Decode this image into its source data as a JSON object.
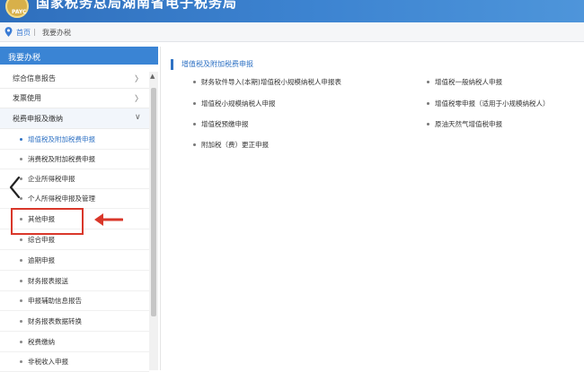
{
  "header": {
    "logo_text": "PAYC",
    "site_title": "国家税务总局湖南省电子税务局"
  },
  "breadcrumb": {
    "home": "首页",
    "separator": "|",
    "current": "我要办税"
  },
  "sidebar": {
    "title": "我要办税",
    "menu": [
      {
        "label": "综合信息报告",
        "arrow": "〉"
      },
      {
        "label": "发票使用",
        "arrow": "〉"
      },
      {
        "label": "税费申报及缴纳",
        "arrow": "∨"
      }
    ],
    "sub_items": [
      {
        "label": "增值税及附加税费申报"
      },
      {
        "label": "消费税及附加税费申报"
      },
      {
        "label": "企业所得税申报"
      },
      {
        "label": "个人所得税申报及管理"
      },
      {
        "label": "其他申报"
      },
      {
        "label": "综合申报"
      },
      {
        "label": "逾期申报"
      },
      {
        "label": "财务报表报送"
      },
      {
        "label": "申报辅助信息报告"
      },
      {
        "label": "财务报表数据转换"
      },
      {
        "label": "税费缴纳"
      },
      {
        "label": "非税收入申报"
      }
    ]
  },
  "content": {
    "section_title": "增值税及附加税费申报",
    "links": [
      "财务软件导入(本期)增值税小规模纳税人申报表",
      "增值税一般纳税人申报",
      "增值税小规模纳税人申报",
      "增值税零申报（适用于小规模纳税人）",
      "增值税预缴申报",
      "原油天然气增值税申报",
      "附加税（费）更正申报"
    ]
  },
  "colors": {
    "accent": "#2f72c4",
    "header_blue": "#3a84d4",
    "annotation_red": "#d9372a"
  }
}
